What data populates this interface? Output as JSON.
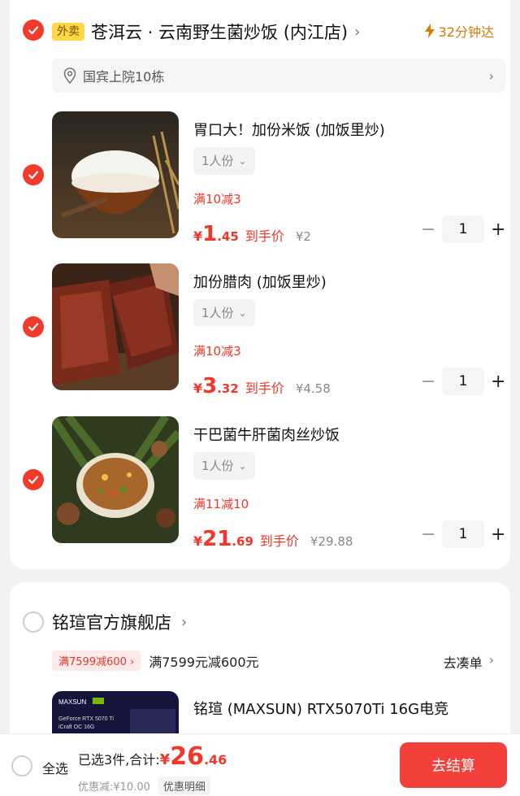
{
  "store1": {
    "badge": "外卖",
    "name": "苍洱云 · 云南野生菌炒饭 (内江店)",
    "eta": "32分钟达",
    "address": "国宾上院10栋"
  },
  "items": [
    {
      "name": "胃口大！加份米饭 (加饭里炒)",
      "spec": "1人份",
      "promo": "满10减3",
      "price_symbol": "¥",
      "price_int": "1",
      "price_dec": ".45",
      "price_tag": "到手价",
      "orig_price": "¥2",
      "qty": "1"
    },
    {
      "name": "加份腊肉 (加饭里炒)",
      "spec": "1人份",
      "promo": "满10减3",
      "price_symbol": "¥",
      "price_int": "3",
      "price_dec": ".32",
      "price_tag": "到手价",
      "orig_price": "¥4.58",
      "qty": "1"
    },
    {
      "name": "干巴菌牛肝菌肉丝炒饭",
      "spec": "1人份",
      "promo": "满11减10",
      "price_symbol": "¥",
      "price_int": "21",
      "price_dec": ".69",
      "price_tag": "到手价",
      "orig_price": "¥29.88",
      "qty": "1"
    }
  ],
  "store2": {
    "name": "铭瑄官方旗舰店",
    "promo_badge": "满7599减600",
    "promo_desc": "满7599元减600元",
    "coudan": "去凑单",
    "item_name": "铭瑄 (MAXSUN) RTX5070Ti 16G电竞",
    "img_brand": "MAXSUN",
    "img_line1": "GeForce RTX 5070 Ti",
    "img_line2": "iCraft OC 16G"
  },
  "bottom": {
    "select_all": "全选",
    "summary": "已选3件,合计:",
    "total_symbol": "¥",
    "total_int": "26",
    "total_dec": ".46",
    "discount": "优惠减:¥10.00",
    "detail": "优惠明细",
    "checkout": "去结算"
  },
  "colors": {
    "accent": "#f2362a",
    "eta": "#d67a00",
    "badge": "#ffd84a"
  }
}
